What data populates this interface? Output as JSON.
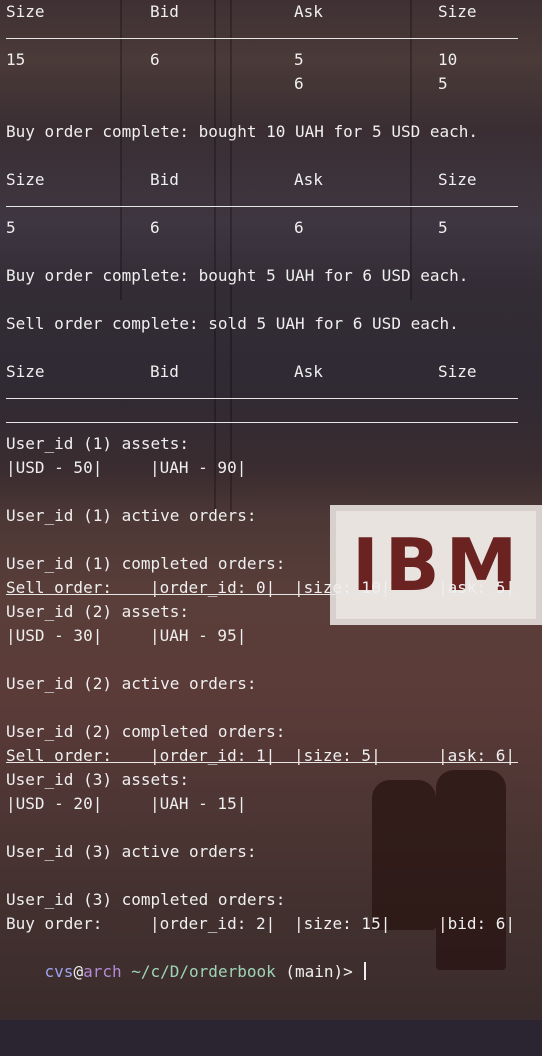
{
  "table_headers": [
    "Size",
    "Bid",
    "Ask",
    "Size"
  ],
  "book1": {
    "rows": [
      [
        "15",
        "6",
        "5",
        "10"
      ],
      [
        "",
        "",
        "6",
        "5"
      ]
    ]
  },
  "msg1": "Buy order complete: bought 10 UAH for 5 USD each.",
  "book2": {
    "rows": [
      [
        "5",
        "6",
        "6",
        "5"
      ]
    ]
  },
  "msg2": "Buy order complete: bought 5 UAH for 6 USD each.",
  "msg3": "Sell order complete: sold 5 UAH for 6 USD each.",
  "users": [
    {
      "assets_title": "User_id (1) assets:",
      "usd": "|USD - 50|",
      "uah": "|UAH - 90|",
      "active_title": "User_id (1) active orders:",
      "completed_title": "User_id (1) completed orders:",
      "order": {
        "type": "Sell order:",
        "id": "|order_id: 0|",
        "size": "|size: 10|",
        "price": "|ask: 5|"
      }
    },
    {
      "assets_title": "User_id (2) assets:",
      "usd": "|USD - 30|",
      "uah": "|UAH - 95|",
      "active_title": "User_id (2) active orders:",
      "completed_title": "User_id (2) completed orders:",
      "order": {
        "type": "Sell order:",
        "id": "|order_id: 1|",
        "size": "|size: 5|",
        "price": "|ask: 6|"
      }
    },
    {
      "assets_title": "User_id (3) assets:",
      "usd": "|USD - 20|",
      "uah": "|UAH - 15|",
      "active_title": "User_id (3) active orders:",
      "completed_title": "User_id (3) completed orders:",
      "order": {
        "type": "Buy order:",
        "id": "|order_id: 2|",
        "size": "|size: 15|",
        "price": "|bid: 6|"
      }
    }
  ],
  "prompt": {
    "user": "cvs",
    "at": "@",
    "host": "arch",
    "path": " ~/c/D/orderbook",
    "branch": " (main)>"
  },
  "background_sign": "IBM",
  "colors": {
    "text": "#efefef",
    "prompt_user": "#9ea3f0",
    "prompt_host": "#b48ad6",
    "prompt_path": "#9fd5b5"
  }
}
